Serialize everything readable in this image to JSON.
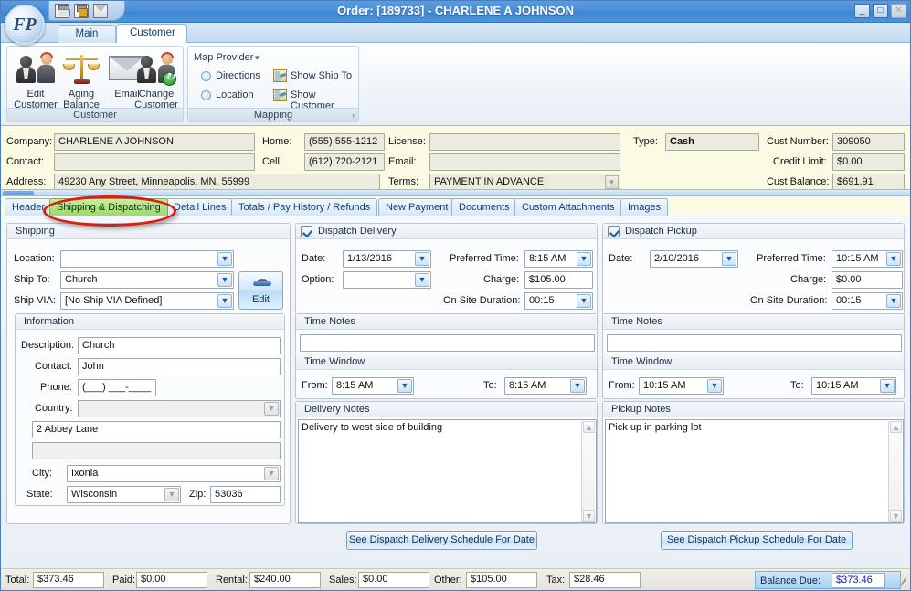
{
  "window": {
    "title": "Order: [189733] - CHARLENE A JOHNSON",
    "minimize": "_",
    "maximize": "□",
    "close": "✕",
    "quick_access": [
      "save-icon",
      "save-as-icon",
      "email-icon"
    ],
    "logo": "FP"
  },
  "ribbon": {
    "tabs": [
      {
        "label": "Main",
        "active": false
      },
      {
        "label": "Customer",
        "active": true
      }
    ],
    "groups": [
      {
        "label": "Customer",
        "buttons": [
          {
            "line1": "Edit",
            "line2": "Customer",
            "icon": "edit-customer-icon"
          },
          {
            "line1": "Aging",
            "line2": "Balance",
            "icon": "aging-balance-icon"
          },
          {
            "line1": "Email",
            "line2": "",
            "icon": "email-icon"
          },
          {
            "line1": "Change",
            "line2": "Customer",
            "icon": "change-customer-icon"
          }
        ]
      },
      {
        "label": "Mapping",
        "map_provider_label": "Map Provider",
        "radios": [
          {
            "label": "Directions",
            "checked": false
          },
          {
            "label": "Location",
            "checked": false
          }
        ],
        "links": [
          {
            "label": "Show Ship To",
            "icon": "map-icon"
          },
          {
            "label": "Show Customer",
            "icon": "map-icon"
          }
        ],
        "expand_arrow": "›"
      }
    ]
  },
  "header": {
    "company": {
      "label": "Company:",
      "value": "CHARLENE A JOHNSON"
    },
    "contact": {
      "label": "Contact:",
      "value": ""
    },
    "address": {
      "label": "Address:",
      "value": "49230 Any Street, Minneapolis, MN, 55999"
    },
    "home": {
      "label": "Home:",
      "value": "(555) 555-1212"
    },
    "cell": {
      "label": "Cell:",
      "value": "(612) 720-2121"
    },
    "terms": {
      "label": "Terms:",
      "value": "PAYMENT IN ADVANCE"
    },
    "license": {
      "label": "License:",
      "value": ""
    },
    "email": {
      "label": "Email:",
      "value": ""
    },
    "type": {
      "label": "Type:",
      "value": "Cash"
    },
    "cust_number": {
      "label": "Cust Number:",
      "value": "309050"
    },
    "credit_limit": {
      "label": "Credit Limit:",
      "value": "$0.00"
    },
    "cust_balance": {
      "label": "Cust Balance:",
      "value": "$691.91"
    }
  },
  "page_tabs": [
    {
      "label": "Header",
      "active": false
    },
    {
      "label": "Shipping & Dispatching",
      "active": true
    },
    {
      "label": "Detail Lines",
      "active": false
    },
    {
      "label": "Totals / Pay History / Refunds",
      "active": false
    },
    {
      "label": "New Payment",
      "active": false
    },
    {
      "label": "Documents",
      "active": false
    },
    {
      "label": "Custom Attachments",
      "active": false
    },
    {
      "label": "Images",
      "active": false
    }
  ],
  "shipping": {
    "title": "Shipping",
    "location": {
      "label": "Location:",
      "value": ""
    },
    "ship_to": {
      "label": "Ship To:",
      "value": "Church"
    },
    "ship_via": {
      "label": "Ship VIA:",
      "value": "[No Ship VIA Defined]"
    },
    "edit_button": "Edit",
    "information": {
      "title": "Information",
      "description": {
        "label": "Description:",
        "value": "Church"
      },
      "contact": {
        "label": "Contact:",
        "value": "John"
      },
      "phone": {
        "label": "Phone:",
        "value": "(___) ___-____"
      },
      "country": {
        "label": "Country:",
        "value": ""
      },
      "address1": "2 Abbey Lane",
      "address2": "",
      "city": {
        "label": "City:",
        "value": "Ixonia"
      },
      "state": {
        "label": "State:",
        "value": "Wisconsin"
      },
      "zip": {
        "label": "Zip:",
        "value": "53036"
      }
    }
  },
  "delivery": {
    "title": "Dispatch Delivery",
    "checked": true,
    "date": {
      "label": "Date:",
      "value": "1/13/2016"
    },
    "option": {
      "label": "Option:",
      "value": ""
    },
    "preferred_time": {
      "label": "Preferred Time:",
      "value": "8:15 AM"
    },
    "charge": {
      "label": "Charge:",
      "value": "$105.00"
    },
    "on_site_duration": {
      "label": "On Site Duration:",
      "value": "00:15"
    },
    "time_notes": {
      "title": "Time Notes",
      "value": ""
    },
    "time_window": {
      "title": "Time Window",
      "from_label": "From:",
      "from": "8:15 AM",
      "to_label": "To:",
      "to": "8:15 AM"
    },
    "notes": {
      "title": "Delivery Notes",
      "value": "Delivery to west side of building"
    },
    "schedule_button": "See Dispatch Delivery Schedule For Date"
  },
  "pickup": {
    "title": "Dispatch Pickup",
    "checked": true,
    "date": {
      "label": "Date:",
      "value": "2/10/2016"
    },
    "preferred_time": {
      "label": "Preferred Time:",
      "value": "10:15 AM"
    },
    "charge": {
      "label": "Charge:",
      "value": "$0.00"
    },
    "on_site_duration": {
      "label": "On Site Duration:",
      "value": "00:15"
    },
    "time_notes": {
      "title": "Time Notes",
      "value": ""
    },
    "time_window": {
      "title": "Time Window",
      "from_label": "From:",
      "from": "10:15 AM",
      "to_label": "To:",
      "to": "10:15 AM"
    },
    "notes": {
      "title": "Pickup Notes",
      "value": "Pick up in parking lot"
    },
    "schedule_button": "See Dispatch Pickup Schedule For Date"
  },
  "status": {
    "total": {
      "label": "Total:",
      "value": "$373.46"
    },
    "paid": {
      "label": "Paid:",
      "value": "$0.00"
    },
    "rental": {
      "label": "Rental:",
      "value": "$240.00"
    },
    "sales": {
      "label": "Sales:",
      "value": "$0.00"
    },
    "other": {
      "label": "Other:",
      "value": "$105.00"
    },
    "tax": {
      "label": "Tax:",
      "value": "$28.46"
    },
    "balance_due": {
      "label": "Balance Due:",
      "value": "$373.46"
    }
  },
  "colors": {
    "accent": "#4a8ed6",
    "active_tab": "#9ed86a",
    "annotation": "#e01b10",
    "header_bg": "#fbfbe4",
    "balance_due_text": "#1616c8"
  }
}
